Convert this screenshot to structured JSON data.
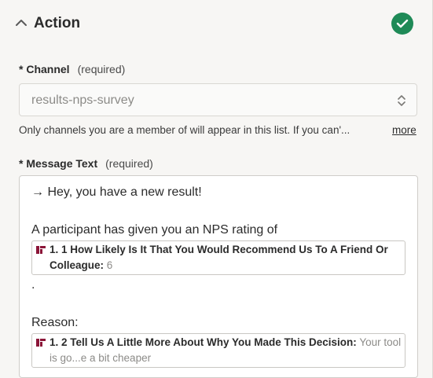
{
  "action": {
    "title": "Action"
  },
  "channel": {
    "label": "* Channel",
    "required": "(required)",
    "value": "results-nps-survey",
    "help": "Only channels you are a member of will appear in this list. If you can'...",
    "more": "more"
  },
  "message": {
    "label": "* Message Text",
    "required": "(required)",
    "line1": "→ Hey, you have a new result!",
    "line2": "A participant has given you an NPS rating of",
    "field1": {
      "key": "1. 1 How Likely Is It That You Would Recommend Us To A Friend Or Colleague:",
      "value": "6"
    },
    "line3": ".",
    "line4": "Reason:",
    "field2": {
      "key": "1. 2 Tell Us A Little More About Why You Made This Decision:",
      "value": "Your tool is go...e a bit cheaper"
    }
  },
  "colors": {
    "accent": "#1f8a57",
    "app_icon": "#8b1538"
  }
}
